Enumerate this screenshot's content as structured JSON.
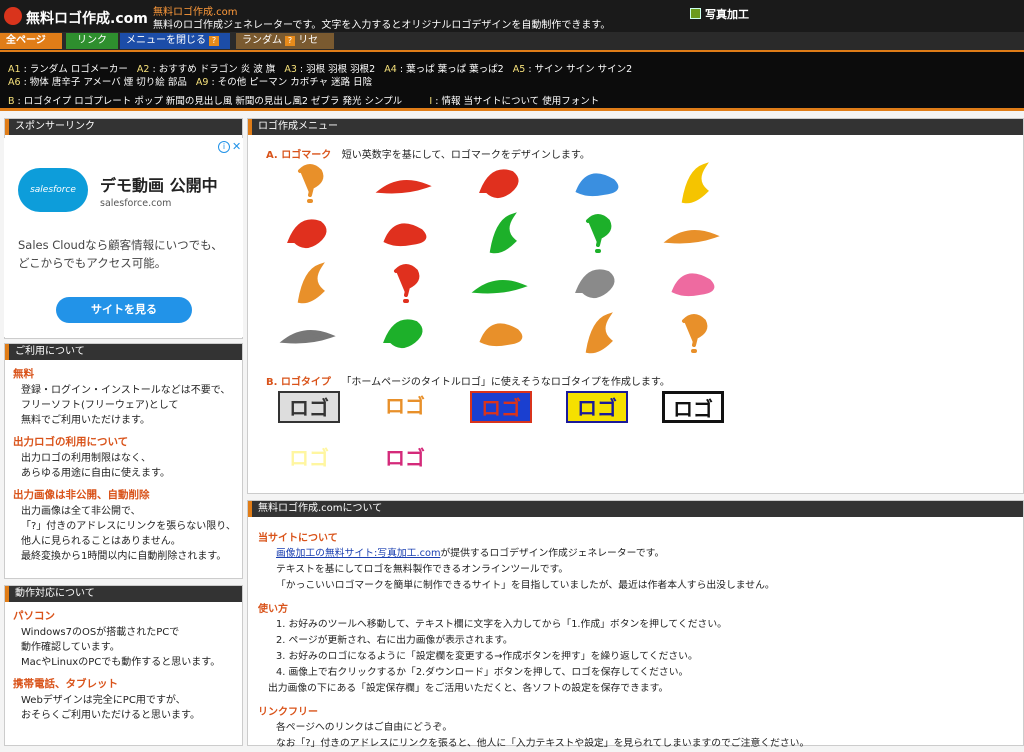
{
  "header": {
    "site_title": "無料ロゴ作成.com",
    "sub_title": "無料ロゴ作成.com",
    "sub_desc": "無料のロゴ作成ジェネレーターです。文字を入力するとオリジナルロゴデザインを自動制作できます。",
    "photo_link": "写真加工"
  },
  "nav": {
    "all_pages": "全ページ",
    "link": "リンク",
    "close_menu": "メニューを閉じる",
    "random": "ランダム",
    "reset": "リセット"
  },
  "submenu": {
    "row1": [
      {
        "code": "A1",
        "items": "ランダム ロゴメーカー"
      },
      {
        "code": "A2",
        "items": "おすすめ ドラゴン 炎 波 旗"
      },
      {
        "code": "A3",
        "items": "羽根 羽根 羽根2"
      },
      {
        "code": "A4",
        "items": "葉っぱ 葉っぱ 葉っぱ2"
      },
      {
        "code": "A5",
        "items": "サイン サイン サイン2"
      }
    ],
    "row2": [
      {
        "code": "A6",
        "items": "物体 唐辛子 アメーバ 煙 切り絵 部品"
      },
      {
        "code": "A9",
        "items": "その他 ピーマン カボチャ 迷路 日陰"
      }
    ],
    "row3": [
      {
        "code": "B",
        "items": "ロゴタイプ ロゴプレート ポップ 新聞の見出し風 新聞の見出し風2 ゼブラ 発光 シンプル"
      },
      {
        "code": "I",
        "items": "情報 当サイトについて 使用フォント"
      }
    ]
  },
  "sponsor": {
    "heading": "スポンサーリンク",
    "ad_brand": "salesforce",
    "ad_title": "デモ動画 公開中",
    "ad_url": "salesforce.com",
    "ad_body_1": "Sales Cloudなら顧客情報にいつでも、",
    "ad_body_2": "どこからでもアクセス可能。",
    "ad_button": "サイトを見る"
  },
  "usage": {
    "heading": "ご利用について",
    "s1_head": "無料",
    "s1_lines": [
      "登録・ログイン・インストールなどは不要で、",
      "フリーソフト(フリーウェア)として",
      "無料でご利用いただけます。"
    ],
    "s2_head": "出力ロゴの利用について",
    "s2_lines": [
      "出力ロゴの利用制限はなく、",
      "あらゆる用途に自由に使えます。"
    ],
    "s3_head": "出力画像は非公開、自動削除",
    "s3_lines": [
      "出力画像は全て非公開で、",
      "「?」付きのアドレスにリンクを張らない限り、",
      "他人に見られることはありません。",
      "最終変換から1時間以内に自動削除されます。"
    ]
  },
  "compat": {
    "heading": "動作対応について",
    "s1_head": "パソコン",
    "s1_lines": [
      "Windows7のOSが搭載されたPCで",
      "動作確認しています。",
      "MacやLinuxのPCでも動作すると思います。"
    ],
    "s2_head": "携帯電話、タブレット",
    "s2_lines": [
      "Webデザインは完全にPC用ですが、",
      "おそらくご利用いただけると思います。"
    ]
  },
  "menu": {
    "heading": "ロゴ作成メニュー",
    "a_label": "A. ロゴマーク",
    "a_desc": "短い英数字を基にして、ロゴマークをデザインします。",
    "b_label": "B. ロゴタイプ",
    "b_desc": "「ホームページのタイトルロゴ」に使えそうなロゴタイプを作成します。",
    "marks": [
      {
        "name": "question-mark-logo",
        "color": "#e8902a"
      },
      {
        "name": "dragon-logo",
        "color": "#e0301e"
      },
      {
        "name": "flame-logo",
        "color": "#e0301e"
      },
      {
        "name": "wave-logo",
        "color": "#3a8fe0"
      },
      {
        "name": "flag-logo",
        "color": "#f5c400"
      },
      {
        "name": "feather-logo-1",
        "color": "#e0301e"
      },
      {
        "name": "feather-logo-2",
        "color": "#e0301e"
      },
      {
        "name": "feather-logo-3",
        "color": "#1db02a"
      },
      {
        "name": "leaf-logo-1",
        "color": "#1db02a"
      },
      {
        "name": "leaf-logo-2",
        "color": "#e8902a"
      },
      {
        "name": "sign-logo-1",
        "color": "#e8902a"
      },
      {
        "name": "chili-logo",
        "color": "#e0301e"
      },
      {
        "name": "amoeba-logo",
        "color": "#1db02a"
      },
      {
        "name": "smoke-logo",
        "color": "#8a8a8a"
      },
      {
        "name": "cutout-logo",
        "color": "#ee6aa0"
      },
      {
        "name": "part-logo",
        "color": "#777777"
      },
      {
        "name": "pepper-logo",
        "color": "#1db02a"
      },
      {
        "name": "pumpkin-logo",
        "color": "#e8902a"
      },
      {
        "name": "maze-logo",
        "color": "#e8902a"
      },
      {
        "name": "shade-logo",
        "color": "#e8902a"
      }
    ],
    "types": [
      {
        "name": "logotype-plate",
        "text": "ロゴ",
        "color": "#333333",
        "bg": "#dddddd"
      },
      {
        "name": "logotype-pop",
        "text": "ロゴ",
        "color": "#e8902a",
        "bg": "#ffffff"
      },
      {
        "name": "logotype-news",
        "text": "ロゴ",
        "color": "#d9341c",
        "bg": "#1a3fd0"
      },
      {
        "name": "logotype-news2",
        "text": "ロゴ",
        "color": "#1a1a9a",
        "bg": "#f5e000"
      },
      {
        "name": "logotype-zebra",
        "text": "ロゴ",
        "color": "#111111",
        "bg": "#ffffff"
      },
      {
        "name": "logotype-glow",
        "text": "ロゴ",
        "color": "#fff6a0",
        "bg": "#ffffff"
      },
      {
        "name": "logotype-simple",
        "text": "ロゴ",
        "color": "#d42a7a",
        "bg": "#ffffff"
      }
    ]
  },
  "about": {
    "heading": "無料ロゴ作成.comについて",
    "s1_head": "当サイトについて",
    "s1_link": "画像加工の無料サイト:写真加工.com",
    "s1_after_link": "が提供するロゴデザイン作成ジェネレーターです。",
    "s1_lines": [
      "テキストを基にしてロゴを無料製作できるオンラインツールです。",
      "「かっこいいロゴマークを簡単に制作できるサイト」を目指していましたが、最近は作者本人すら出没しません。"
    ],
    "s2_head": "使い方",
    "s2_lines": [
      "1. お好みのツールへ移動して、テキスト欄に文字を入力してから「1.作成」ボタンを押してください。",
      "2. ページが更新され、右に出力画像が表示されます。",
      "3. お好みのロゴになるように「設定欄を変更する→作成ボタンを押す」を繰り返してください。",
      "4. 画像上で右クリックするか「2.ダウンロード」ボタンを押して、ロゴを保存してください。",
      "出力画像の下にある「設定保存欄」をご活用いただくと、各ソフトの設定を保存できます。"
    ],
    "s3_head": "リンクフリー",
    "s3_lines": [
      "各ページへのリンクはご自由にどうぞ。",
      "なお「?」付きのアドレスにリンクを張ると、他人に「入力テキストや設定」を見られてしまいますのでご注意ください。"
    ]
  }
}
